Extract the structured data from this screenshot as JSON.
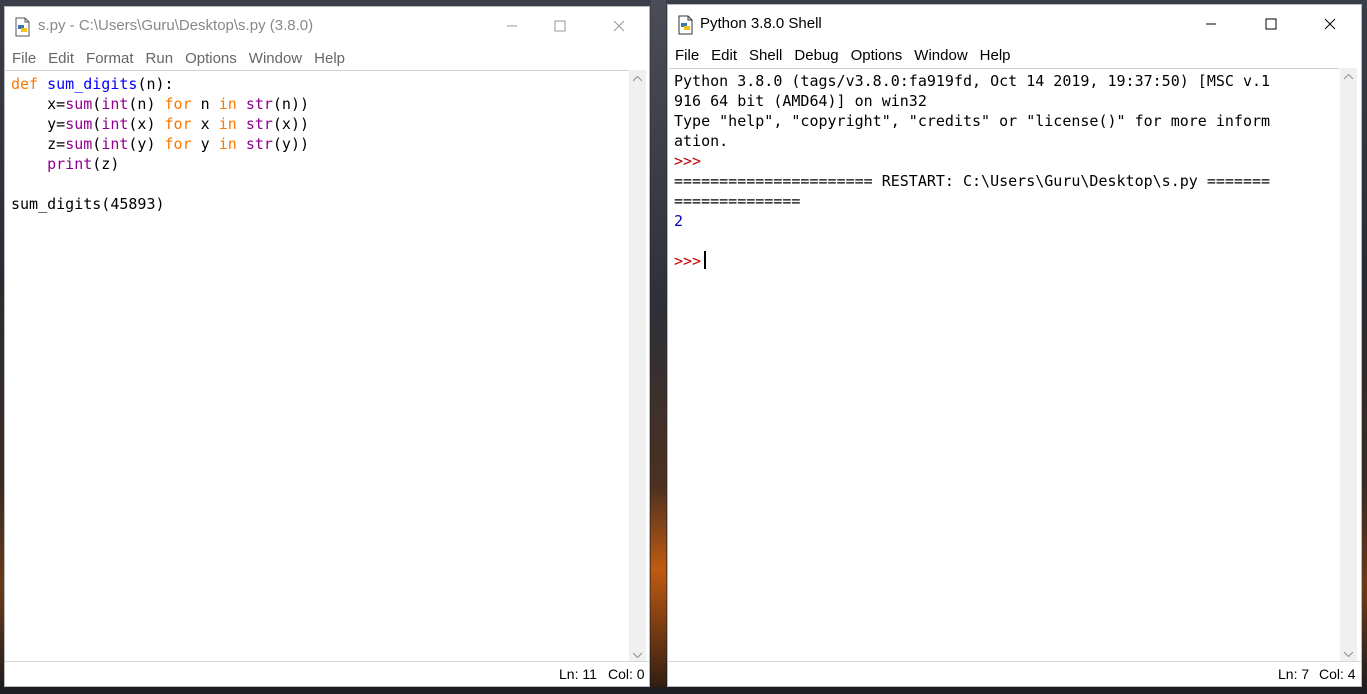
{
  "editor": {
    "title": "s.py - C:\\Users\\Guru\\Desktop\\s.py (3.8.0)",
    "menu": [
      "File",
      "Edit",
      "Format",
      "Run",
      "Options",
      "Window",
      "Help"
    ],
    "code": {
      "l1_def": "def",
      "l1_name": "sum_digits",
      "l1_rest": "(n):",
      "l2_a": "    x=",
      "l2_sum": "sum",
      "l2_b": "(",
      "l2_int": "int",
      "l2_c": "(n) ",
      "l2_for": "for",
      "l2_d": " n ",
      "l2_in": "in",
      "l2_e": " ",
      "l2_str": "str",
      "l2_f": "(n))",
      "l3_a": "    y=",
      "l3_sum": "sum",
      "l3_b": "(",
      "l3_int": "int",
      "l3_c": "(x) ",
      "l3_for": "for",
      "l3_d": " x ",
      "l3_in": "in",
      "l3_e": " ",
      "l3_str": "str",
      "l3_f": "(x))",
      "l4_a": "    z=",
      "l4_sum": "sum",
      "l4_b": "(",
      "l4_int": "int",
      "l4_c": "(y) ",
      "l4_for": "for",
      "l4_d": " y ",
      "l4_in": "in",
      "l4_e": " ",
      "l4_str": "str",
      "l4_f": "(y))",
      "l5_a": "    ",
      "l5_print": "print",
      "l5_b": "(z)",
      "l7": "sum_digits(45893)"
    },
    "status": {
      "ln": "Ln: 11",
      "col": "Col: 0"
    }
  },
  "shell": {
    "title": "Python 3.8.0 Shell",
    "menu": [
      "File",
      "Edit",
      "Shell",
      "Debug",
      "Options",
      "Window",
      "Help"
    ],
    "lines": {
      "banner1": "Python 3.8.0 (tags/v3.8.0:fa919fd, Oct 14 2019, 19:37:50) [MSC v.1",
      "banner2": "916 64 bit (AMD64)] on win32",
      "banner3": "Type \"help\", \"copyright\", \"credits\" or \"license()\" for more inform",
      "banner4": "ation.",
      "prompt1": ">>>",
      "restart1": "====================== RESTART: C:\\Users\\Guru\\Desktop\\s.py =======",
      "restart2": "==============",
      "output": "2",
      "prompt2": ">>>"
    },
    "status": {
      "ln": "Ln: 7",
      "col": "Col: 4"
    }
  },
  "icons": {
    "app": "python-file-icon",
    "minimize": "minimize-icon",
    "maximize": "maximize-icon",
    "close": "close-icon"
  }
}
